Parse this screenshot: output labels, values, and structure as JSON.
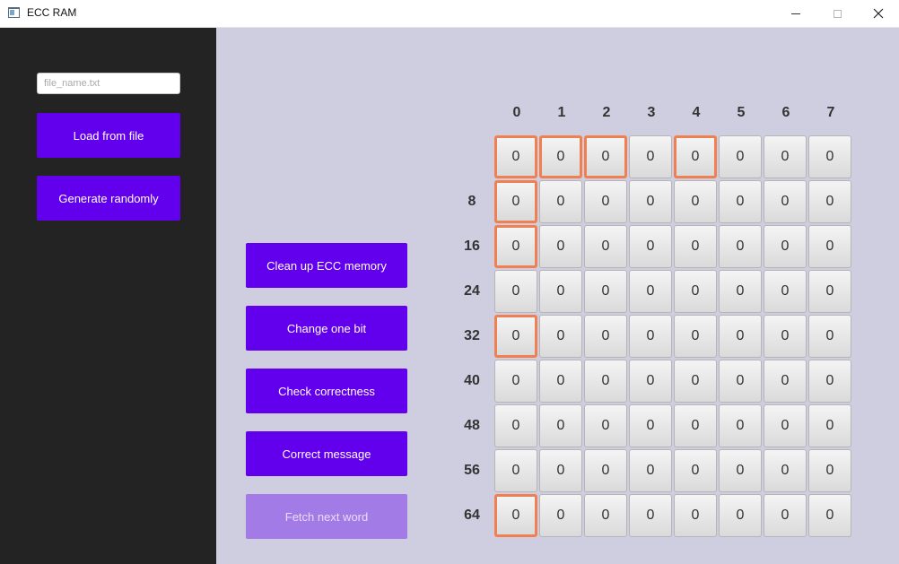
{
  "window": {
    "title": "ECC RAM",
    "icon": "app-window-icon"
  },
  "sidebar": {
    "file_input": {
      "placeholder": "file_name.txt",
      "value": ""
    },
    "load_button": "Load from file",
    "generate_button": "Generate randomly"
  },
  "actions": {
    "clean_up": "Clean up ECC memory",
    "change_bit": "Change one bit",
    "check": "Check correctness",
    "correct": "Correct message",
    "fetch_next": "Fetch next word",
    "fetch_next_disabled": true
  },
  "grid": {
    "column_headers": [
      "0",
      "1",
      "2",
      "3",
      "4",
      "5",
      "6",
      "7"
    ],
    "row_headers": [
      "",
      "8",
      "16",
      "24",
      "32",
      "40",
      "48",
      "56",
      "64"
    ],
    "highlight_color": "#f08050",
    "cells": [
      [
        "0",
        "0",
        "0",
        "0",
        "0",
        "0",
        "0",
        "0"
      ],
      [
        "0",
        "0",
        "0",
        "0",
        "0",
        "0",
        "0",
        "0"
      ],
      [
        "0",
        "0",
        "0",
        "0",
        "0",
        "0",
        "0",
        "0"
      ],
      [
        "0",
        "0",
        "0",
        "0",
        "0",
        "0",
        "0",
        "0"
      ],
      [
        "0",
        "0",
        "0",
        "0",
        "0",
        "0",
        "0",
        "0"
      ],
      [
        "0",
        "0",
        "0",
        "0",
        "0",
        "0",
        "0",
        "0"
      ],
      [
        "0",
        "0",
        "0",
        "0",
        "0",
        "0",
        "0",
        "0"
      ],
      [
        "0",
        "0",
        "0",
        "0",
        "0",
        "0",
        "0",
        "0"
      ],
      [
        "0",
        "0",
        "0",
        "0",
        "0",
        "0",
        "0",
        "0"
      ]
    ],
    "highlighted": [
      [
        0,
        0
      ],
      [
        0,
        1
      ],
      [
        0,
        2
      ],
      [
        0,
        4
      ],
      [
        1,
        0
      ],
      [
        2,
        0
      ],
      [
        4,
        0
      ],
      [
        8,
        0
      ]
    ]
  },
  "colors": {
    "accent": "#6200ee",
    "accent_disabled": "#a37be6",
    "sidebar_bg": "#232323",
    "content_bg": "#cfcde0"
  }
}
